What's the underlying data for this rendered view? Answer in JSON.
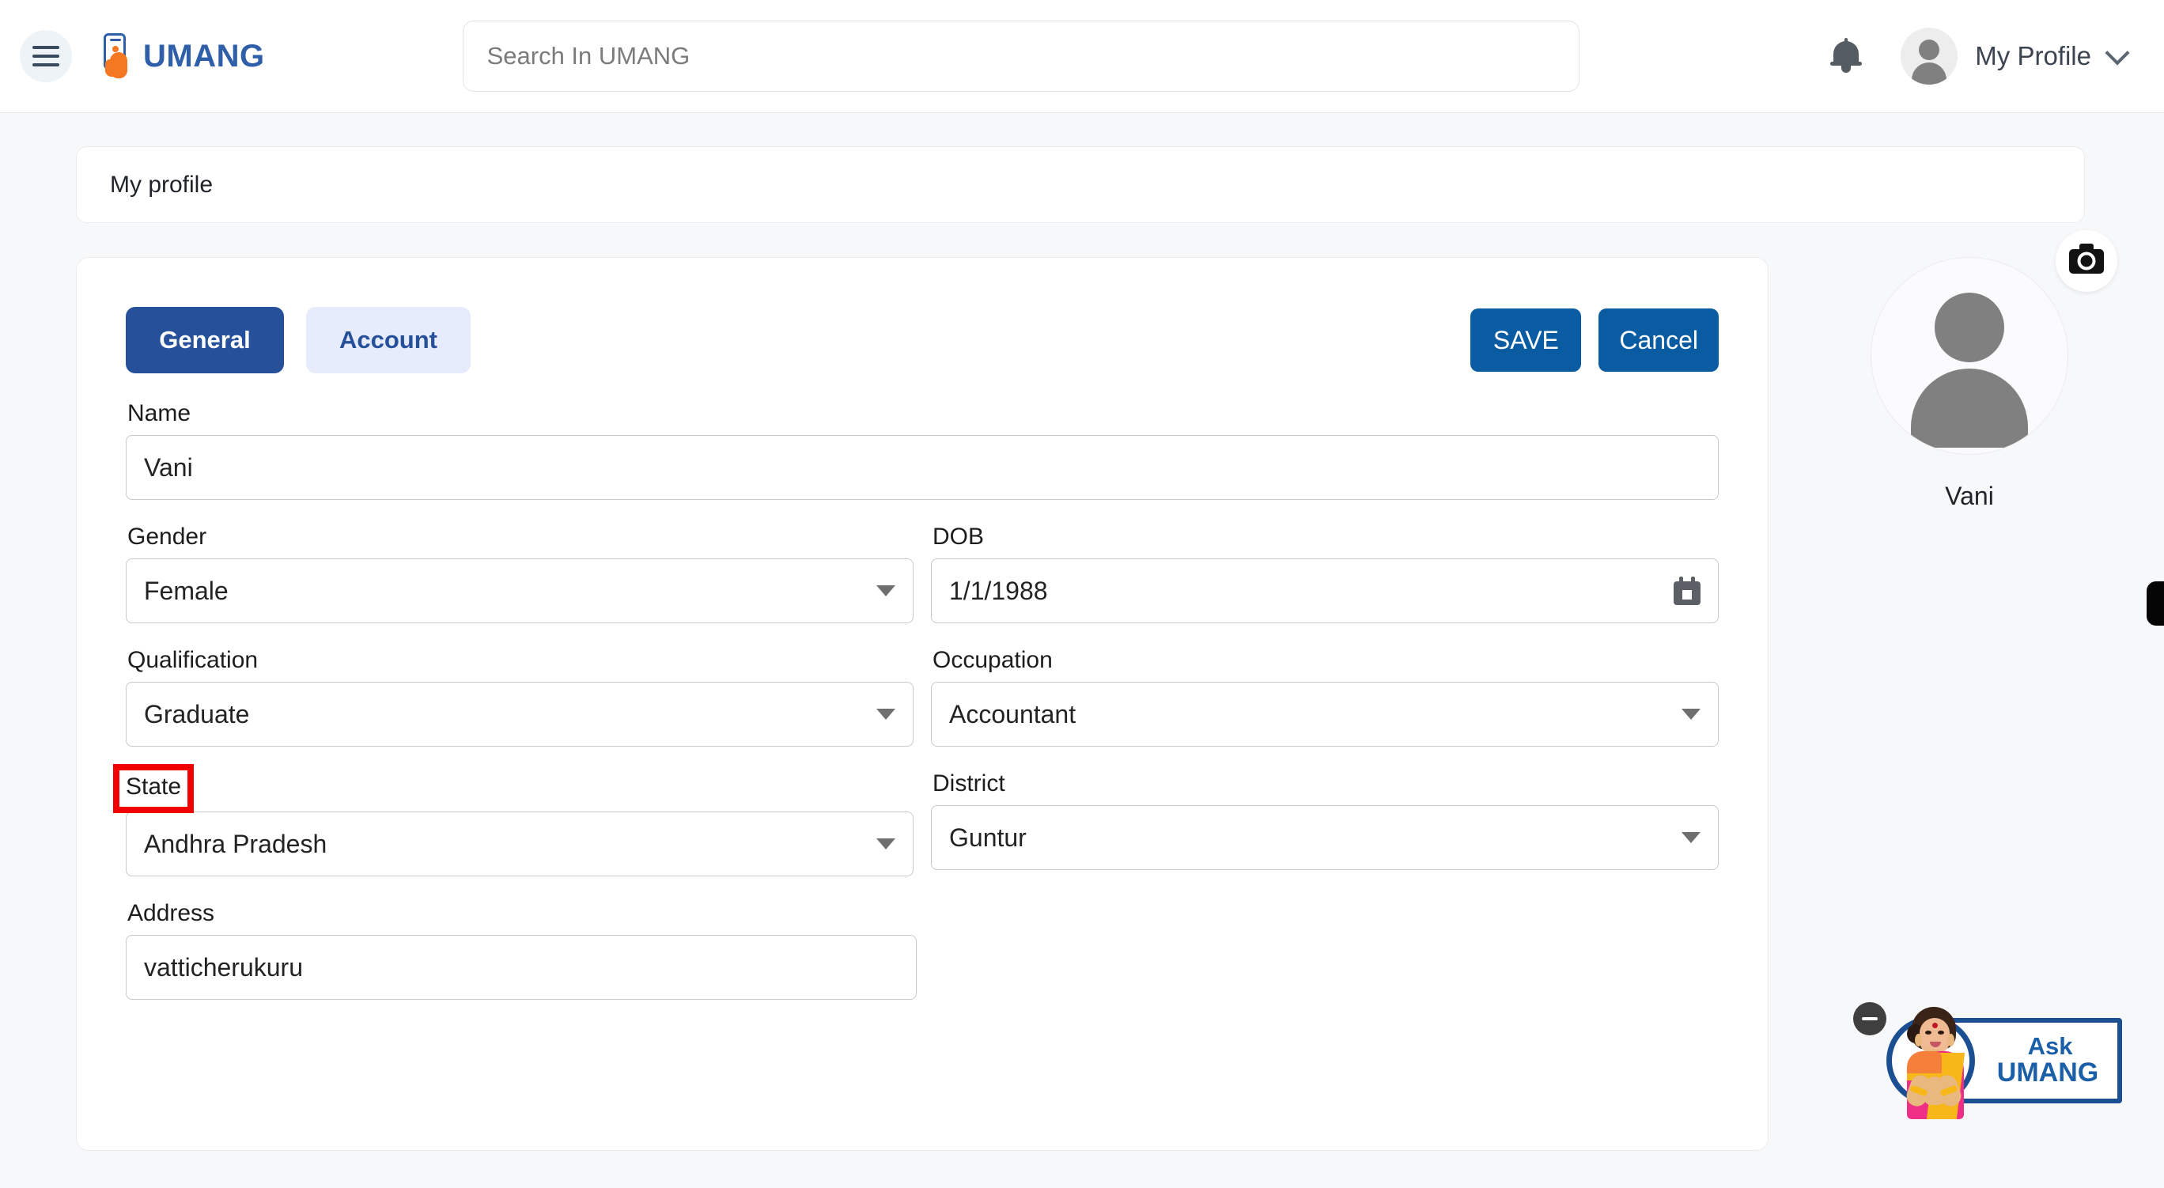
{
  "header": {
    "menu_icon": "hamburger-icon",
    "brand": "UMANG",
    "search": {
      "value": "",
      "placeholder": "Search In UMANG"
    },
    "notifications_icon": "bell-icon",
    "profile_label": "My Profile",
    "profile_chevron_icon": "chevron-down-icon"
  },
  "breadcrumb": {
    "title": "My profile"
  },
  "form": {
    "tabs": [
      {
        "label": "General",
        "active": true
      },
      {
        "label": "Account",
        "active": false
      }
    ],
    "actions": [
      {
        "label": "SAVE"
      },
      {
        "label": "Cancel"
      }
    ],
    "fields": {
      "name": {
        "label": "Name",
        "value": "Vani"
      },
      "gender": {
        "label": "Gender",
        "value": "Female"
      },
      "dob": {
        "label": "DOB",
        "value": "1/1/1988",
        "icon": "calendar-icon"
      },
      "qualification": {
        "label": "Qualification",
        "value": "Graduate"
      },
      "occupation": {
        "label": "Occupation",
        "value": "Accountant"
      },
      "state": {
        "label": "State",
        "value": "Andhra Pradesh",
        "highlighted": true
      },
      "district": {
        "label": "District",
        "value": "Guntur"
      },
      "address": {
        "label": "Address",
        "value": "vatticherukuru"
      }
    }
  },
  "side_panel": {
    "avatar_icon": "user-avatar-icon",
    "camera_icon": "camera-icon",
    "name": "Vani"
  },
  "ask_widget": {
    "minimize_icon": "minimize-icon",
    "line1": "Ask",
    "line2": "UMANG",
    "assistant_icon": "assistant-avatar-icon"
  },
  "edge_tab": {
    "icon": "side-panel-handle-icon"
  },
  "colors": {
    "page_bg": "#f7f8fa",
    "brand_blue": "#2f5fa8",
    "brand_orange": "#f47721",
    "tab_active_bg": "#27509b",
    "tab_inactive_bg": "#e6ecfb",
    "action_blue": "#0a5ca2",
    "highlight_red": "#f20000"
  }
}
